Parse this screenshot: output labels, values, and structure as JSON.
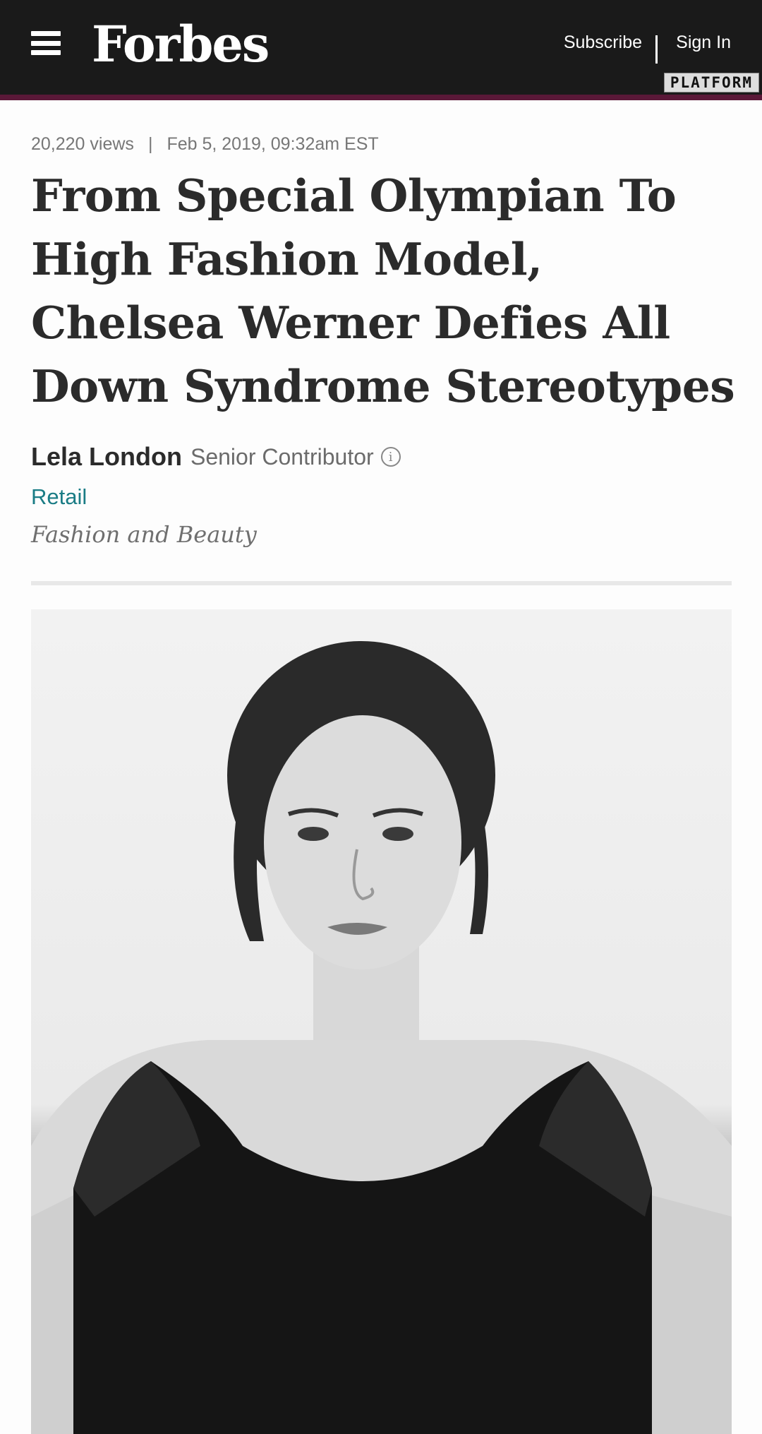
{
  "header": {
    "logo_text": "Forbes",
    "subscribe_label": "Subscribe",
    "signin_label": "Sign In",
    "badge_text": "PLATFORM",
    "menu_icon": "hamburger-menu-icon",
    "colors": {
      "bar": "#1a1a1a",
      "stripe": "#5a1838"
    }
  },
  "article": {
    "views": "20,220 views",
    "separator": "|",
    "date": "Feb 5, 2019,",
    "time": "09:32am EST",
    "headline": "From Special Olympian To High Fashion Model, Chelsea Werner Defies All Down Syndrome Stereotypes",
    "author": "Lela London",
    "author_role": "Senior Contributor",
    "info_icon": "info-icon",
    "channel": "Retail",
    "section": "Fashion and Beauty",
    "colors": {
      "channel": "#1a7c85"
    }
  }
}
